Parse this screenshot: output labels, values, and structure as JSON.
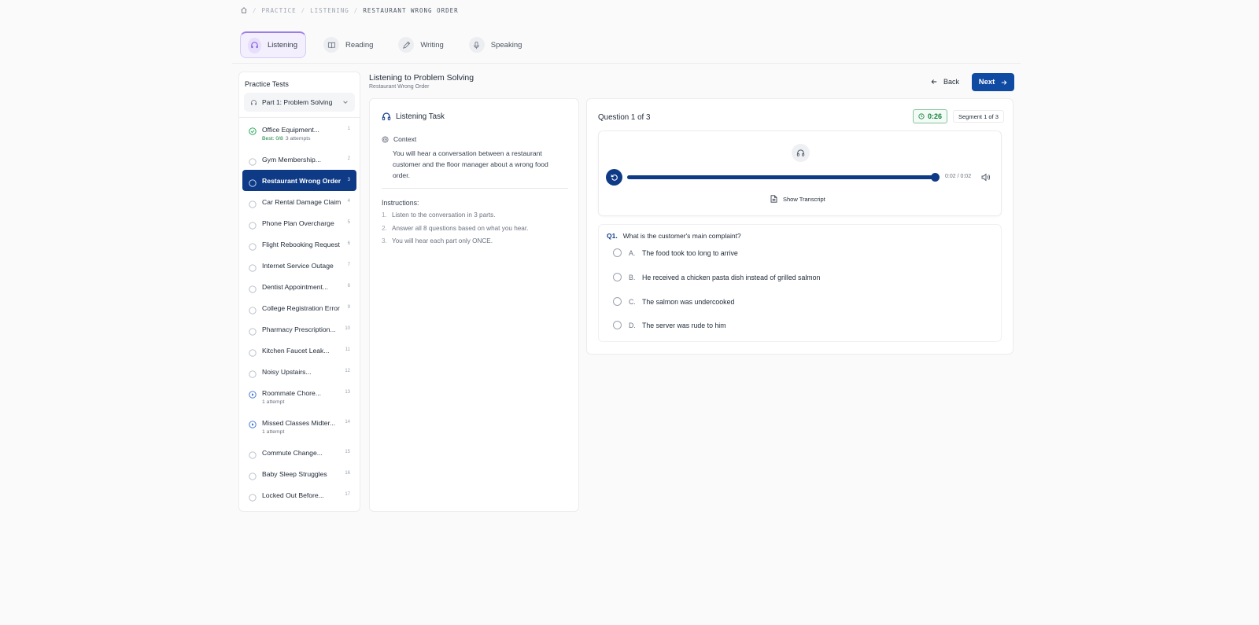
{
  "breadcrumb": {
    "items": [
      "PRACTICE",
      "LISTENING",
      "RESTAURANT WRONG ORDER"
    ],
    "separator": "/"
  },
  "skill_tabs": [
    {
      "label": "Listening",
      "icon": "headphones-icon",
      "active": true
    },
    {
      "label": "Reading",
      "icon": "book-icon",
      "active": false
    },
    {
      "label": "Writing",
      "icon": "pen-icon",
      "active": false
    },
    {
      "label": "Speaking",
      "icon": "microphone-icon",
      "active": false
    }
  ],
  "sidebar": {
    "title": "Practice Tests",
    "part_select": "Part 1: Problem Solving",
    "tests": [
      {
        "name": "Office Equipment...",
        "num": "1",
        "status": "completed",
        "best_label": "Best: 0/8",
        "attempts": "3 attempts"
      },
      {
        "name": "Gym Membership...",
        "num": "2",
        "status": "none"
      },
      {
        "name": "Restaurant Wrong Order",
        "num": "3",
        "status": "active"
      },
      {
        "name": "Car Rental Damage Claim",
        "num": "4",
        "status": "none"
      },
      {
        "name": "Phone Plan Overcharge",
        "num": "5",
        "status": "none"
      },
      {
        "name": "Flight Rebooking Request",
        "num": "6",
        "status": "none"
      },
      {
        "name": "Internet Service Outage",
        "num": "7",
        "status": "none"
      },
      {
        "name": "Dentist Appointment...",
        "num": "8",
        "status": "none"
      },
      {
        "name": "College Registration Error",
        "num": "9",
        "status": "none"
      },
      {
        "name": "Pharmacy Prescription...",
        "num": "10",
        "status": "none"
      },
      {
        "name": "Kitchen Faucet Leak...",
        "num": "11",
        "status": "none"
      },
      {
        "name": "Noisy Upstairs...",
        "num": "12",
        "status": "none"
      },
      {
        "name": "Roommate Chore...",
        "num": "13",
        "status": "in-progress",
        "attempts": "1 attempt"
      },
      {
        "name": "Missed Classes Midter...",
        "num": "14",
        "status": "in-progress",
        "attempts": "1 attempt"
      },
      {
        "name": "Commute Change...",
        "num": "15",
        "status": "none"
      },
      {
        "name": "Baby Sleep Struggles",
        "num": "16",
        "status": "none"
      },
      {
        "name": "Locked Out Before...",
        "num": "17",
        "status": "none"
      }
    ]
  },
  "header": {
    "title": "Listening to Problem Solving",
    "subtitle": "Restaurant Wrong Order",
    "back_label": "Back",
    "next_label": "Next"
  },
  "task": {
    "title": "Listening Task",
    "context_label": "Context",
    "context_text": "You will hear a conversation between a restaurant customer and the floor manager about a wrong food order.",
    "instructions_title": "Instructions:",
    "instructions": [
      "Listen to the conversation in 3 parts.",
      "Answer all 8 questions based on what you hear.",
      "You will hear each part only ONCE."
    ]
  },
  "question": {
    "counter": "Question 1 of 3",
    "timer": "0:26",
    "segment": "Segment 1 of 3",
    "audio_time": "0:02 / 0:02",
    "audio_progress": 1.0,
    "transcript_label": "Show Transcript",
    "number": "Q1.",
    "text": "What is the customer's main complaint?",
    "options": [
      {
        "letter": "A.",
        "text": "The food took too long to arrive"
      },
      {
        "letter": "B.",
        "text": "He received a chicken pasta dish instead of grilled salmon"
      },
      {
        "letter": "C.",
        "text": "The salmon was undercooked"
      },
      {
        "letter": "D.",
        "text": "The server was rude to him"
      }
    ]
  },
  "colors": {
    "primary": "#0f3b86",
    "button": "#0f4aa3",
    "accent_purple": "#9b7de8",
    "success": "#15803d"
  }
}
